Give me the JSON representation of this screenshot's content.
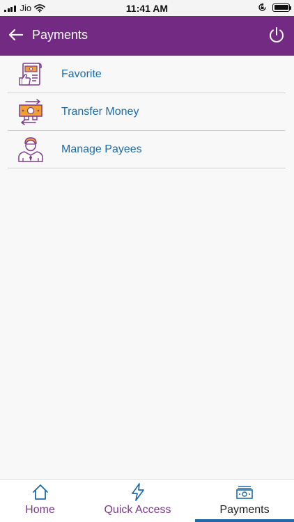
{
  "status_bar": {
    "carrier": "Jio",
    "time": "11:41 AM",
    "icons": [
      "signal-icon",
      "wifi-icon",
      "orientation-lock-icon",
      "battery-icon"
    ]
  },
  "header": {
    "title": "Payments",
    "back_icon": "arrow-left-icon",
    "power_icon": "power-icon",
    "background": "#732a82"
  },
  "menu": {
    "items": [
      {
        "label": "Favorite",
        "icon": "favorite-bill-icon"
      },
      {
        "label": "Transfer Money",
        "icon": "transfer-money-icon"
      },
      {
        "label": "Manage Payees",
        "icon": "payee-person-icon"
      }
    ],
    "label_color": "#1d6aa6",
    "icon_colors": {
      "primary": "#7e3a8c",
      "accent": "#f0a030"
    }
  },
  "bottom_nav": {
    "items": [
      {
        "label": "Home",
        "icon": "home-icon",
        "active": false
      },
      {
        "label": "Quick Access",
        "icon": "lightning-icon",
        "active": false
      },
      {
        "label": "Payments",
        "icon": "banknote-icon",
        "active": true
      }
    ],
    "active_indicator_color": "#1d6aa6"
  }
}
